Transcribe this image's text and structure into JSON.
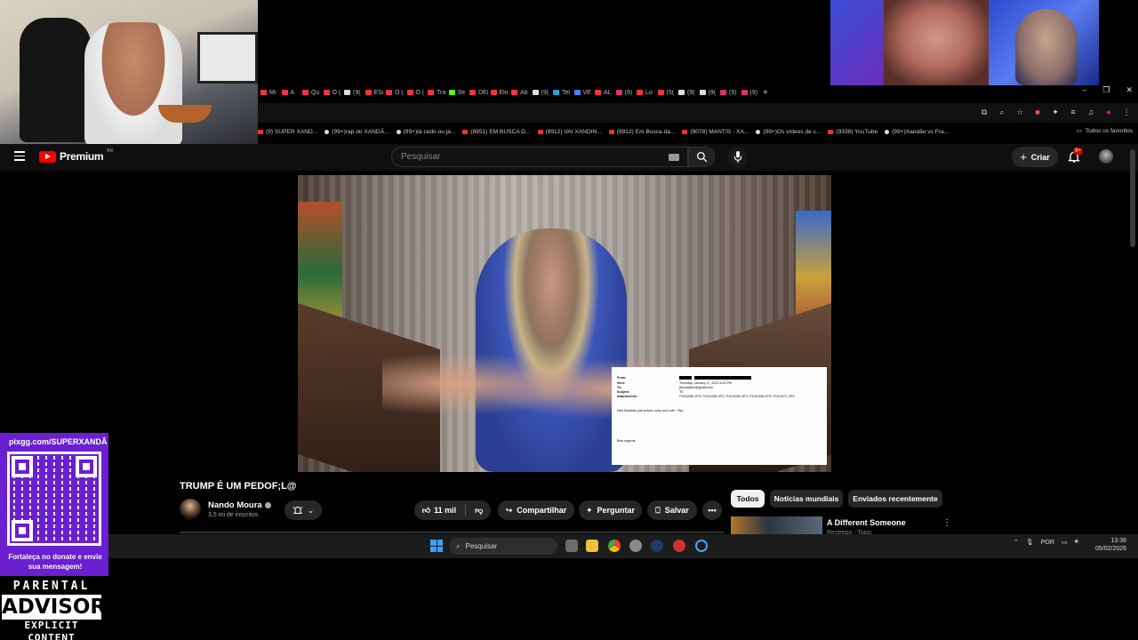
{
  "browser": {
    "tabs": [
      {
        "label": "Mi",
        "color": "#ff3333"
      },
      {
        "label": "A ",
        "color": "#ff3333"
      },
      {
        "label": "Qu",
        "color": "#ff3333"
      },
      {
        "label": "O (",
        "color": "#ff3333"
      },
      {
        "label": "(9(",
        "color": "#dddddd"
      },
      {
        "label": "ES(",
        "color": "#ff3333"
      },
      {
        "label": "O (",
        "color": "#ff3333"
      },
      {
        "label": "O (",
        "color": "#ff3333"
      },
      {
        "label": "Tra",
        "color": "#ff3333"
      },
      {
        "label": "Str",
        "color": "#53fc18"
      },
      {
        "label": "DE(",
        "color": "#ff3333"
      },
      {
        "label": "Elo",
        "color": "#ff3333"
      },
      {
        "label": "Ab",
        "color": "#ff3333"
      },
      {
        "label": "(9(",
        "color": "#dddddd"
      },
      {
        "label": "Tel",
        "color": "#2aa3e0"
      },
      {
        "label": "VE",
        "color": "#4285f4"
      },
      {
        "label": "AL",
        "color": "#ff3333"
      },
      {
        "label": "(9)",
        "color": "#e1306c"
      },
      {
        "label": "Lo",
        "color": "#ff3333"
      },
      {
        "label": "(5(",
        "color": "#ff3333"
      },
      {
        "label": "(9(",
        "color": "#dddddd"
      },
      {
        "label": "(9(",
        "color": "#dddddd"
      },
      {
        "label": "(9)",
        "color": "#e1306c"
      },
      {
        "label": "(9)",
        "color": "#e1306c"
      }
    ],
    "new_tab": "+",
    "bookmarks": [
      {
        "label": "(9) SUPER XAND...",
        "type": "yt"
      },
      {
        "label": "(99+)rap do XANDÃ...",
        "type": "tk"
      },
      {
        "label": "(99+)tá cedo ou já...",
        "type": "tk"
      },
      {
        "label": "(8851) EM BUSCA D...",
        "type": "yt"
      },
      {
        "label": "(8912) VAI XANDIN...",
        "type": "yt"
      },
      {
        "label": "(8912) Em Busca da...",
        "type": "yt"
      },
      {
        "label": "(9078) MANTIS - XA...",
        "type": "yt"
      },
      {
        "label": "(99+)Os vídeos de c...",
        "type": "tk"
      },
      {
        "label": "(9338) YouTube",
        "type": "yt"
      },
      {
        "label": "(99+)Xandão vs Fra...",
        "type": "tk"
      }
    ],
    "all_favorites": "Todos os favoritos"
  },
  "youtube": {
    "logo_text": "Premium",
    "region": "BR",
    "search_placeholder": "Pesquisar",
    "create_label": "Criar",
    "notification_badge": "9+"
  },
  "video": {
    "title": "TRUMP É UM PEDOF;L@",
    "channel": "Nando Moura",
    "subscribers": "3,5 mi de inscritos",
    "likes": "11 mil",
    "share_label": "Compartilhar",
    "ask_label": "Perguntar",
    "save_label": "Salvar",
    "email_doc": {
      "from_label": "From:",
      "sent_label": "Sent:",
      "sent_value": "Thursday, January 17, 2013 4:43 PM",
      "to_label": "To:",
      "to_value": "jeevacation@gmail.com",
      "subject_label": "Subject:",
      "subject_value": "TE",
      "attachments_label": "Attachments:",
      "attachments_value": "P1010280.JPG; P1010282.JPG; P1010283.JPG; P1010285.JPG; P1010271.JPG",
      "body": "New Brazilian just arrived, sexy and cute, +9yo",
      "closing": "Best regards,"
    }
  },
  "sidebar": {
    "chips": [
      "Todos",
      "Notícias mundiais",
      "Enviados recentemente"
    ],
    "recommendation": {
      "title": "A Different Someone",
      "channel": "Restrepo - Topic"
    }
  },
  "taskbar": {
    "search_placeholder": "Pesquisar",
    "language": "POR",
    "time": "13:36",
    "date": "05/02/2026"
  },
  "overlay": {
    "qr_url": "pixgg.com/SUPERXANDÃ",
    "qr_message": "Fortaleça no donate e envie sua mensagem!",
    "advisory_line1": "PARENTAL",
    "advisory_line2": "ADVISORY",
    "advisory_line3": "EXPLICIT CONTENT"
  }
}
